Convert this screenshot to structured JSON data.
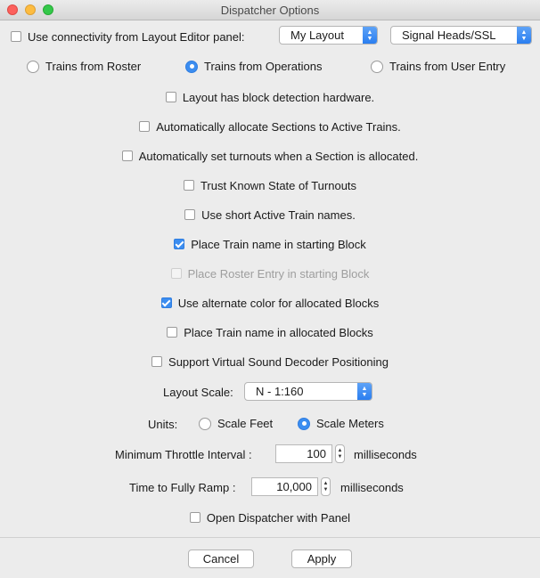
{
  "window": {
    "title": "Dispatcher Options"
  },
  "connectivity": {
    "label": "Use connectivity from Layout Editor panel:",
    "checked": false,
    "layout_select": "My Layout",
    "signal_select": "Signal Heads/SSL"
  },
  "train_source": {
    "options": [
      "Trains from Roster",
      "Trains from Operations",
      "Trains from User Entry"
    ],
    "selected_index": 1
  },
  "options": [
    {
      "label": "Layout has block detection hardware.",
      "checked": false,
      "disabled": false
    },
    {
      "label": "Automatically allocate Sections to Active Trains.",
      "checked": false,
      "disabled": false
    },
    {
      "label": "Automatically set turnouts when a Section is allocated.",
      "checked": false,
      "disabled": false
    },
    {
      "label": "Trust Known State of Turnouts",
      "checked": false,
      "disabled": false
    },
    {
      "label": "Use short Active Train names.",
      "checked": false,
      "disabled": false
    },
    {
      "label": "Place Train name in starting Block",
      "checked": true,
      "disabled": false
    },
    {
      "label": "Place Roster Entry in starting Block",
      "checked": false,
      "disabled": true
    },
    {
      "label": "Use alternate color for allocated Blocks",
      "checked": true,
      "disabled": false
    },
    {
      "label": "Place Train name in allocated Blocks",
      "checked": false,
      "disabled": false
    },
    {
      "label": "Support Virtual Sound Decoder Positioning",
      "checked": false,
      "disabled": false
    }
  ],
  "layout_scale": {
    "label": "Layout Scale:",
    "value": "N - 1:160"
  },
  "units": {
    "label": "Units:",
    "options": [
      "Scale Feet",
      "Scale Meters"
    ],
    "selected_index": 1
  },
  "throttle": {
    "label": "Minimum Throttle Interval :",
    "value": "100",
    "unit": "milliseconds"
  },
  "ramp": {
    "label": "Time to Fully Ramp :",
    "value": "10,000",
    "unit": "milliseconds"
  },
  "open_with_panel": {
    "label": "Open Dispatcher with Panel",
    "checked": false
  },
  "buttons": {
    "cancel": "Cancel",
    "apply": "Apply"
  }
}
